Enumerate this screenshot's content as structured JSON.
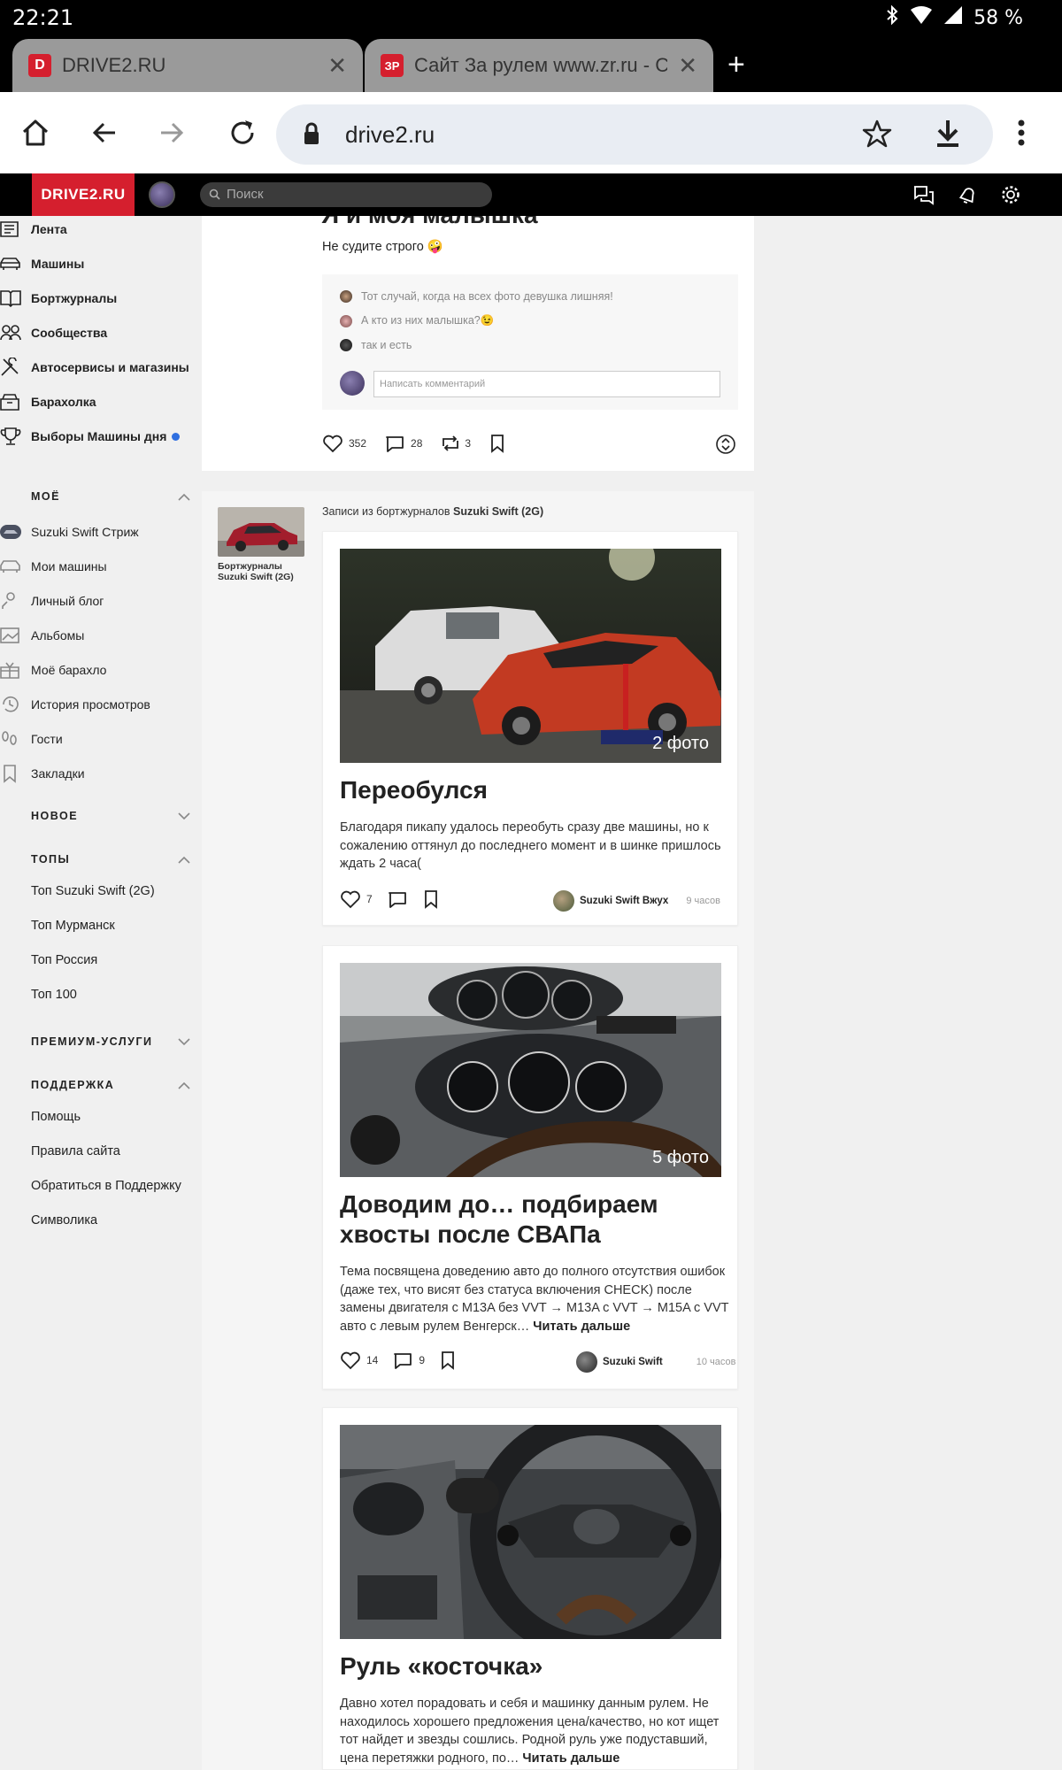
{
  "status_bar": {
    "time": "22:21",
    "battery": "58 %"
  },
  "tabs": [
    {
      "favicon": "D",
      "favicon_color": "#d51f2e",
      "title": "DRIVE2.RU",
      "active": false
    },
    {
      "favicon": "ЗР",
      "favicon_color": "#d51f2e",
      "title": "Сайт За рулем www.zr.ru - Ст",
      "active": true
    }
  ],
  "toolbar": {
    "url": "drive2.ru"
  },
  "site": {
    "logo": "DRIVE2.RU",
    "search_placeholder": "Поиск"
  },
  "nav": {
    "main": [
      {
        "label": "Лента",
        "icon": "feed-icon"
      },
      {
        "label": "Машины",
        "icon": "car-icon"
      },
      {
        "label": "Бортжурналы",
        "icon": "book-icon"
      },
      {
        "label": "Сообщества",
        "icon": "people-icon"
      },
      {
        "label": "Автосервисы и магазины",
        "icon": "wrench-icon"
      },
      {
        "label": "Барахолка",
        "icon": "box-icon"
      },
      {
        "label": "Выборы Машины дня",
        "icon": "trophy-icon"
      }
    ],
    "sections": {
      "mine": "МОЁ",
      "new": "НОВОЕ",
      "tops": "ТОПЫ",
      "premium": "ПРЕМИУМ-УСЛУГИ",
      "support": "ПОДДЕРЖКА"
    },
    "mine_items": [
      {
        "label": "Suzuki Swift Стриж",
        "icon": "car-thumb-icon"
      },
      {
        "label": "Мои машины",
        "icon": "car-outline-icon"
      },
      {
        "label": "Личный блог",
        "icon": "person-pen-icon"
      },
      {
        "label": "Альбомы",
        "icon": "album-icon"
      },
      {
        "label": "Моё барахло",
        "icon": "gift-icon"
      },
      {
        "label": "История просмотров",
        "icon": "history-icon"
      },
      {
        "label": "Гости",
        "icon": "footprints-icon"
      },
      {
        "label": "Закладки",
        "icon": "bookmark-icon"
      }
    ],
    "tops_items": [
      "Топ Suzuki Swift (2G)",
      "Топ Мурманск",
      "Топ Россия",
      "Топ 100"
    ],
    "support_items": [
      "Помощь",
      "Правила сайта",
      "Обратиться в Поддержку",
      "Символика"
    ]
  },
  "top_post": {
    "title": "Я и моя малышка",
    "text": "Не судите строго 🤪",
    "comments": [
      "Тот случай, когда на всех фото девушка лишняя!",
      "А кто из них малышка?😉",
      "так и есть"
    ],
    "comment_placeholder": "Написать комментарий",
    "likes": "352",
    "comments_count": "28",
    "reposts": "3"
  },
  "logbook": {
    "header_prefix": "Записи из бортжурналов",
    "header_car": "Suzuki Swift (2G)",
    "thumb_caption_line1": "Бортжурналы",
    "thumb_caption_line2": "Suzuki Swift (2G)"
  },
  "posts": [
    {
      "photo_count": "2 фото",
      "title": "Переобулся",
      "text": "Благодаря пикапу удалось переобуть сразу две машины, но к сожалению оттянул до последнего момент и в шинке пришлось ждать 2 часа(",
      "likes": "7",
      "comments": "",
      "author": "Suzuki Swift Вжух",
      "time": "9 часов"
    },
    {
      "photo_count": "5 фото",
      "title": "Доводим до… подбираем хвосты после СВАПа",
      "text": "Тема посвящена доведению авто до полного отсутствия ошибок (даже тех, что висят без статуса включения CHECK) после замены двигателя с M13A без VVT → M13A с VVT → M15A с VVT авто с левым рулем Венгерск…",
      "read_more": "Читать дальше",
      "likes": "14",
      "comments": "9",
      "author": "Suzuki Swift",
      "time": "10 часов"
    },
    {
      "photo_count": "",
      "title": "Руль «косточка»",
      "text": "Давно хотел порадовать и себя и машинку данным рулем. Не находилось хорошего предложения цена/качество, но кот ищет тот найдет и звезды сошлись. Родной руль уже подуставший, цена перетяжки родного, по…",
      "read_more": "Читать дальше"
    }
  ]
}
